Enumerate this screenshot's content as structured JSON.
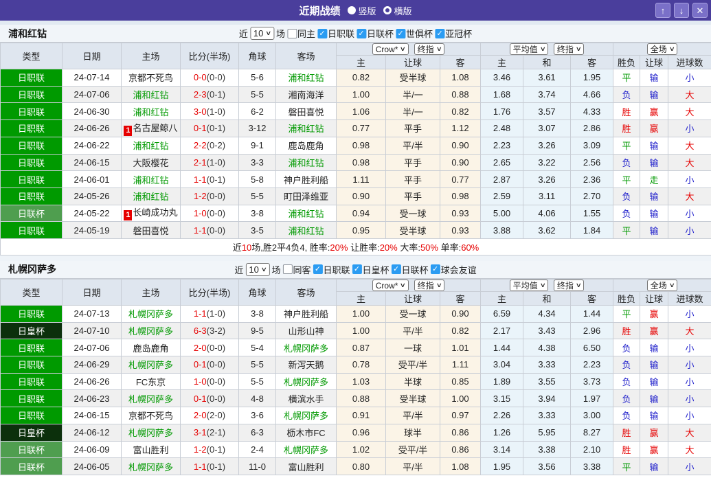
{
  "title_bar": {
    "title": "近期战绩",
    "view_options": [
      {
        "label": "竖版",
        "selected": true
      },
      {
        "label": "横版",
        "selected": false
      }
    ],
    "window_buttons": {
      "up": "↑",
      "down": "↓",
      "close": "✕"
    }
  },
  "table_header": {
    "static_columns": [
      "类型",
      "日期",
      "主场",
      "比分(半场)",
      "角球",
      "客场"
    ],
    "odds_selects": {
      "crow": "Crow*",
      "final1": "终指",
      "average": "平均值",
      "final2": "终指",
      "fullmatch": "全场"
    },
    "sub_columns": [
      "主",
      "让球",
      "客",
      "主",
      "和",
      "客",
      "胜负",
      "让球",
      "进球数"
    ]
  },
  "colors": {
    "accent_purple": "#4a3e9c",
    "league_green": "#009a00",
    "cup_green": "#4f9e4f",
    "emperor_dark_green": "#0c300c",
    "focus_team_green": "#009900",
    "score_red": "#e60000",
    "win_red": "#e60000",
    "draw_green": "#009900",
    "lose_blue": "#2323cc",
    "checkbox_blue": "#2b9cf2",
    "crow_columns_bg": "#fbf4e7",
    "average_columns_bg": "#eaf4fa"
  },
  "tables": [
    {
      "team": "浦和红钻",
      "filters": {
        "prefix": "近",
        "count": "10",
        "suffix": "场",
        "same_checkbox": {
          "label": "同主",
          "checked": false
        },
        "league_checkboxes": [
          {
            "label": "日职联",
            "checked": true
          },
          {
            "label": "日联杯",
            "checked": true
          },
          {
            "label": "世俱杯",
            "checked": true
          },
          {
            "label": "亚冠杯",
            "checked": true
          }
        ]
      },
      "rows": [
        {
          "type": "日职联",
          "type_style": "league",
          "date": "24-07-14",
          "home": "京都不死鸟",
          "home_focus": false,
          "home_badge": "",
          "score": "0-0",
          "half": "(0-0)",
          "corner": "5-6",
          "away": "浦和红钻",
          "away_focus": true,
          "away_badge": "",
          "crow_home": "0.82",
          "handicap": "受半球",
          "crow_away": "1.08",
          "avg_home": "3.46",
          "avg_draw": "3.61",
          "avg_away": "1.95",
          "result": {
            "text": "平",
            "color": "draw"
          },
          "handicap_result": {
            "text": "输",
            "color": "lose"
          },
          "goals": {
            "text": "小",
            "color": "lose"
          }
        },
        {
          "type": "日职联",
          "type_style": "league",
          "date": "24-07-06",
          "home": "浦和红钻",
          "home_focus": true,
          "home_badge": "",
          "score": "2-3",
          "half": "(0-1)",
          "corner": "5-5",
          "away": "湘南海洋",
          "away_focus": false,
          "away_badge": "",
          "crow_home": "1.00",
          "handicap": "半/一",
          "crow_away": "0.88",
          "avg_home": "1.68",
          "avg_draw": "3.74",
          "avg_away": "4.66",
          "result": {
            "text": "负",
            "color": "lose"
          },
          "handicap_result": {
            "text": "输",
            "color": "lose"
          },
          "goals": {
            "text": "大",
            "color": "win"
          }
        },
        {
          "type": "日职联",
          "type_style": "league",
          "date": "24-06-30",
          "home": "浦和红钻",
          "home_focus": true,
          "home_badge": "",
          "score": "3-0",
          "half": "(1-0)",
          "corner": "6-2",
          "away": "磐田喜悦",
          "away_focus": false,
          "away_badge": "",
          "crow_home": "1.06",
          "handicap": "半/一",
          "crow_away": "0.82",
          "avg_home": "1.76",
          "avg_draw": "3.57",
          "avg_away": "4.33",
          "result": {
            "text": "胜",
            "color": "win"
          },
          "handicap_result": {
            "text": "赢",
            "color": "win"
          },
          "goals": {
            "text": "大",
            "color": "win"
          }
        },
        {
          "type": "日职联",
          "type_style": "league",
          "date": "24-06-26",
          "home": "名古屋鲸八",
          "home_focus": false,
          "home_badge": "1",
          "score": "0-1",
          "half": "(0-1)",
          "corner": "3-12",
          "away": "浦和红钻",
          "away_focus": true,
          "away_badge": "",
          "crow_home": "0.77",
          "handicap": "平手",
          "crow_away": "1.12",
          "avg_home": "2.48",
          "avg_draw": "3.07",
          "avg_away": "2.86",
          "result": {
            "text": "胜",
            "color": "win"
          },
          "handicap_result": {
            "text": "赢",
            "color": "win"
          },
          "goals": {
            "text": "小",
            "color": "lose"
          }
        },
        {
          "type": "日职联",
          "type_style": "league",
          "date": "24-06-22",
          "home": "浦和红钻",
          "home_focus": true,
          "home_badge": "",
          "score": "2-2",
          "half": "(0-2)",
          "corner": "9-1",
          "away": "鹿岛鹿角",
          "away_focus": false,
          "away_badge": "",
          "crow_home": "0.98",
          "handicap": "平/半",
          "crow_away": "0.90",
          "avg_home": "2.23",
          "avg_draw": "3.26",
          "avg_away": "3.09",
          "result": {
            "text": "平",
            "color": "draw"
          },
          "handicap_result": {
            "text": "输",
            "color": "lose"
          },
          "goals": {
            "text": "大",
            "color": "win"
          }
        },
        {
          "type": "日职联",
          "type_style": "league",
          "date": "24-06-15",
          "home": "大阪樱花",
          "home_focus": false,
          "home_badge": "",
          "score": "2-1",
          "half": "(1-0)",
          "corner": "3-3",
          "away": "浦和红钻",
          "away_focus": true,
          "away_badge": "",
          "crow_home": "0.98",
          "handicap": "平手",
          "crow_away": "0.90",
          "avg_home": "2.65",
          "avg_draw": "3.22",
          "avg_away": "2.56",
          "result": {
            "text": "负",
            "color": "lose"
          },
          "handicap_result": {
            "text": "输",
            "color": "lose"
          },
          "goals": {
            "text": "大",
            "color": "win"
          }
        },
        {
          "type": "日职联",
          "type_style": "league",
          "date": "24-06-01",
          "home": "浦和红钻",
          "home_focus": true,
          "home_badge": "",
          "score": "1-1",
          "half": "(0-1)",
          "corner": "5-8",
          "away": "神户胜利船",
          "away_focus": false,
          "away_badge": "",
          "crow_home": "1.11",
          "handicap": "平手",
          "crow_away": "0.77",
          "avg_home": "2.87",
          "avg_draw": "3.26",
          "avg_away": "2.36",
          "result": {
            "text": "平",
            "color": "draw"
          },
          "handicap_result": {
            "text": "走",
            "color": "draw"
          },
          "goals": {
            "text": "小",
            "color": "lose"
          }
        },
        {
          "type": "日职联",
          "type_style": "league",
          "date": "24-05-26",
          "home": "浦和红钻",
          "home_focus": true,
          "home_badge": "",
          "score": "1-2",
          "half": "(0-0)",
          "corner": "5-5",
          "away": "町田泽维亚",
          "away_focus": false,
          "away_badge": "",
          "crow_home": "0.90",
          "handicap": "平手",
          "crow_away": "0.98",
          "avg_home": "2.59",
          "avg_draw": "3.11",
          "avg_away": "2.70",
          "result": {
            "text": "负",
            "color": "lose"
          },
          "handicap_result": {
            "text": "输",
            "color": "lose"
          },
          "goals": {
            "text": "大",
            "color": "win"
          }
        },
        {
          "type": "日联杯",
          "type_style": "cup",
          "date": "24-05-22",
          "home": "长崎成功丸",
          "home_focus": false,
          "home_badge": "1",
          "score": "1-0",
          "half": "(0-0)",
          "corner": "3-8",
          "away": "浦和红钻",
          "away_focus": true,
          "away_badge": "",
          "crow_home": "0.94",
          "handicap": "受一球",
          "crow_away": "0.93",
          "avg_home": "5.00",
          "avg_draw": "4.06",
          "avg_away": "1.55",
          "result": {
            "text": "负",
            "color": "lose"
          },
          "handicap_result": {
            "text": "输",
            "color": "lose"
          },
          "goals": {
            "text": "小",
            "color": "lose"
          }
        },
        {
          "type": "日职联",
          "type_style": "league",
          "date": "24-05-19",
          "home": "磐田喜悦",
          "home_focus": false,
          "home_badge": "",
          "score": "1-1",
          "half": "(0-0)",
          "corner": "3-5",
          "away": "浦和红钻",
          "away_focus": true,
          "away_badge": "",
          "crow_home": "0.95",
          "handicap": "受半球",
          "crow_away": "0.93",
          "avg_home": "3.88",
          "avg_draw": "3.62",
          "avg_away": "1.84",
          "result": {
            "text": "平",
            "color": "draw"
          },
          "handicap_result": {
            "text": "输",
            "color": "lose"
          },
          "goals": {
            "text": "小",
            "color": "lose"
          }
        }
      ],
      "summary": [
        {
          "text": "近",
          "red": false
        },
        {
          "text": "10",
          "red": true
        },
        {
          "text": "场,胜2平4负4, 胜率:",
          "red": false
        },
        {
          "text": "20%",
          "red": true
        },
        {
          "text": " 让胜率:",
          "red": false
        },
        {
          "text": "20%",
          "red": true
        },
        {
          "text": " 大率:",
          "red": false
        },
        {
          "text": "50%",
          "red": true
        },
        {
          "text": " 单率:",
          "red": false
        },
        {
          "text": "60%",
          "red": true
        }
      ]
    },
    {
      "team": "札幌冈萨多",
      "filters": {
        "prefix": "近",
        "count": "10",
        "suffix": "场",
        "same_checkbox": {
          "label": "同客",
          "checked": false
        },
        "league_checkboxes": [
          {
            "label": "日职联",
            "checked": true
          },
          {
            "label": "日皇杯",
            "checked": true
          },
          {
            "label": "日联杯",
            "checked": true
          },
          {
            "label": "球会友谊",
            "checked": true
          }
        ]
      },
      "rows": [
        {
          "type": "日职联",
          "type_style": "league",
          "date": "24-07-13",
          "home": "札幌冈萨多",
          "home_focus": true,
          "home_badge": "",
          "score": "1-1",
          "half": "(1-0)",
          "corner": "3-8",
          "away": "神户胜利船",
          "away_focus": false,
          "away_badge": "",
          "crow_home": "1.00",
          "handicap": "受一球",
          "crow_away": "0.90",
          "avg_home": "6.59",
          "avg_draw": "4.34",
          "avg_away": "1.44",
          "result": {
            "text": "平",
            "color": "draw"
          },
          "handicap_result": {
            "text": "赢",
            "color": "win"
          },
          "goals": {
            "text": "小",
            "color": "lose"
          }
        },
        {
          "type": "日皇杯",
          "type_style": "emperor",
          "date": "24-07-10",
          "home": "札幌冈萨多",
          "home_focus": true,
          "home_badge": "",
          "score": "6-3",
          "half": "(3-2)",
          "corner": "9-5",
          "away": "山形山神",
          "away_focus": false,
          "away_badge": "",
          "crow_home": "1.00",
          "handicap": "平/半",
          "crow_away": "0.82",
          "avg_home": "2.17",
          "avg_draw": "3.43",
          "avg_away": "2.96",
          "result": {
            "text": "胜",
            "color": "win"
          },
          "handicap_result": {
            "text": "赢",
            "color": "win"
          },
          "goals": {
            "text": "大",
            "color": "win"
          }
        },
        {
          "type": "日职联",
          "type_style": "league",
          "date": "24-07-06",
          "home": "鹿岛鹿角",
          "home_focus": false,
          "home_badge": "",
          "score": "2-0",
          "half": "(0-0)",
          "corner": "5-4",
          "away": "札幌冈萨多",
          "away_focus": true,
          "away_badge": "",
          "crow_home": "0.87",
          "handicap": "一球",
          "crow_away": "1.01",
          "avg_home": "1.44",
          "avg_draw": "4.38",
          "avg_away": "6.50",
          "result": {
            "text": "负",
            "color": "lose"
          },
          "handicap_result": {
            "text": "输",
            "color": "lose"
          },
          "goals": {
            "text": "小",
            "color": "lose"
          }
        },
        {
          "type": "日职联",
          "type_style": "league",
          "date": "24-06-29",
          "home": "札幌冈萨多",
          "home_focus": true,
          "home_badge": "",
          "score": "0-1",
          "half": "(0-0)",
          "corner": "5-5",
          "away": "新泻天鹅",
          "away_focus": false,
          "away_badge": "",
          "crow_home": "0.78",
          "handicap": "受平/半",
          "crow_away": "1.11",
          "avg_home": "3.04",
          "avg_draw": "3.33",
          "avg_away": "2.23",
          "result": {
            "text": "负",
            "color": "lose"
          },
          "handicap_result": {
            "text": "输",
            "color": "lose"
          },
          "goals": {
            "text": "小",
            "color": "lose"
          }
        },
        {
          "type": "日职联",
          "type_style": "league",
          "date": "24-06-26",
          "home": "FC东京",
          "home_focus": false,
          "home_badge": "",
          "score": "1-0",
          "half": "(0-0)",
          "corner": "5-5",
          "away": "札幌冈萨多",
          "away_focus": true,
          "away_badge": "",
          "crow_home": "1.03",
          "handicap": "半球",
          "crow_away": "0.85",
          "avg_home": "1.89",
          "avg_draw": "3.55",
          "avg_away": "3.73",
          "result": {
            "text": "负",
            "color": "lose"
          },
          "handicap_result": {
            "text": "输",
            "color": "lose"
          },
          "goals": {
            "text": "小",
            "color": "lose"
          }
        },
        {
          "type": "日职联",
          "type_style": "league",
          "date": "24-06-23",
          "home": "札幌冈萨多",
          "home_focus": true,
          "home_badge": "",
          "score": "0-1",
          "half": "(0-0)",
          "corner": "4-8",
          "away": "横滨水手",
          "away_focus": false,
          "away_badge": "",
          "crow_home": "0.88",
          "handicap": "受半球",
          "crow_away": "1.00",
          "avg_home": "3.15",
          "avg_draw": "3.94",
          "avg_away": "1.97",
          "result": {
            "text": "负",
            "color": "lose"
          },
          "handicap_result": {
            "text": "输",
            "color": "lose"
          },
          "goals": {
            "text": "小",
            "color": "lose"
          }
        },
        {
          "type": "日职联",
          "type_style": "league",
          "date": "24-06-15",
          "home": "京都不死鸟",
          "home_focus": false,
          "home_badge": "",
          "score": "2-0",
          "half": "(2-0)",
          "corner": "3-6",
          "away": "札幌冈萨多",
          "away_focus": true,
          "away_badge": "",
          "crow_home": "0.91",
          "handicap": "平/半",
          "crow_away": "0.97",
          "avg_home": "2.26",
          "avg_draw": "3.33",
          "avg_away": "3.00",
          "result": {
            "text": "负",
            "color": "lose"
          },
          "handicap_result": {
            "text": "输",
            "color": "lose"
          },
          "goals": {
            "text": "小",
            "color": "lose"
          }
        },
        {
          "type": "日皇杯",
          "type_style": "emperor",
          "date": "24-06-12",
          "home": "札幌冈萨多",
          "home_focus": true,
          "home_badge": "",
          "score": "3-1",
          "half": "(2-1)",
          "corner": "6-3",
          "away": "枥木市FC",
          "away_focus": false,
          "away_badge": "",
          "crow_home": "0.96",
          "handicap": "球半",
          "crow_away": "0.86",
          "avg_home": "1.26",
          "avg_draw": "5.95",
          "avg_away": "8.27",
          "result": {
            "text": "胜",
            "color": "win"
          },
          "handicap_result": {
            "text": "赢",
            "color": "win"
          },
          "goals": {
            "text": "大",
            "color": "win"
          }
        },
        {
          "type": "日联杯",
          "type_style": "cup",
          "date": "24-06-09",
          "home": "富山胜利",
          "home_focus": false,
          "home_badge": "",
          "score": "1-2",
          "half": "(0-1)",
          "corner": "2-4",
          "away": "札幌冈萨多",
          "away_focus": true,
          "away_badge": "",
          "crow_home": "1.02",
          "handicap": "受平/半",
          "crow_away": "0.86",
          "avg_home": "3.14",
          "avg_draw": "3.38",
          "avg_away": "2.10",
          "result": {
            "text": "胜",
            "color": "win"
          },
          "handicap_result": {
            "text": "赢",
            "color": "win"
          },
          "goals": {
            "text": "大",
            "color": "win"
          }
        },
        {
          "type": "日联杯",
          "type_style": "cup",
          "date": "24-06-05",
          "home": "札幌冈萨多",
          "home_focus": true,
          "home_badge": "",
          "score": "1-1",
          "half": "(0-1)",
          "corner": "11-0",
          "away": "富山胜利",
          "away_focus": false,
          "away_badge": "",
          "crow_home": "0.80",
          "handicap": "平/半",
          "crow_away": "1.08",
          "avg_home": "1.95",
          "avg_draw": "3.56",
          "avg_away": "3.38",
          "result": {
            "text": "平",
            "color": "draw"
          },
          "handicap_result": {
            "text": "输",
            "color": "lose"
          },
          "goals": {
            "text": "小",
            "color": "lose"
          }
        }
      ],
      "summary": null
    }
  ]
}
